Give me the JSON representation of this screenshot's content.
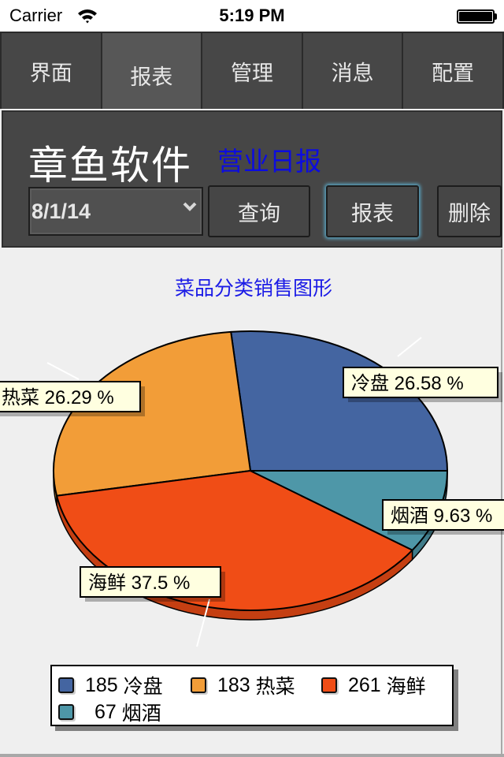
{
  "status_bar": {
    "carrier": "Carrier",
    "time": "5:19 PM",
    "battery_level": 1.0
  },
  "tabs": [
    {
      "label": "界面",
      "active": false
    },
    {
      "label": "报表",
      "active": true
    },
    {
      "label": "管理",
      "active": false
    },
    {
      "label": "消息",
      "active": false
    },
    {
      "label": "配置",
      "active": false
    }
  ],
  "header": {
    "brand": "章鱼软件",
    "report_name": "营业日报",
    "date_value": "8/1/14",
    "buttons": {
      "query": "查询",
      "report": "报表",
      "delete": "删除"
    }
  },
  "colors": {
    "accent_blue": "#1b1be6",
    "slice_cold": "#4465a1",
    "slice_hot": "#f29d38",
    "slice_seafood": "#f04d16",
    "slice_tobacco": "#4e97a8",
    "label_bg": "#ffffe0"
  },
  "chart_data": {
    "type": "pie",
    "style": "3d",
    "title": "菜品分类销售图形",
    "categories": [
      "冷盘",
      "热菜",
      "海鲜",
      "烟酒"
    ],
    "values": [
      185,
      183,
      261,
      67
    ],
    "percent_labels": [
      "冷盘 26.58 %",
      "热菜 26.29 %",
      "海鲜 37.5 %",
      "烟酒 9.63 %"
    ],
    "percents": [
      26.58,
      26.29,
      37.5,
      9.63
    ],
    "colors": [
      "#4465a1",
      "#f29d38",
      "#f04d16",
      "#4e97a8"
    ],
    "legend": {
      "position": "bottom",
      "entries": [
        {
          "value": "185",
          "label": "冷盘"
        },
        {
          "value": "183",
          "label": "热菜"
        },
        {
          "value": "261",
          "label": "海鲜"
        },
        {
          "value": "67",
          "label": "烟酒"
        }
      ]
    }
  }
}
